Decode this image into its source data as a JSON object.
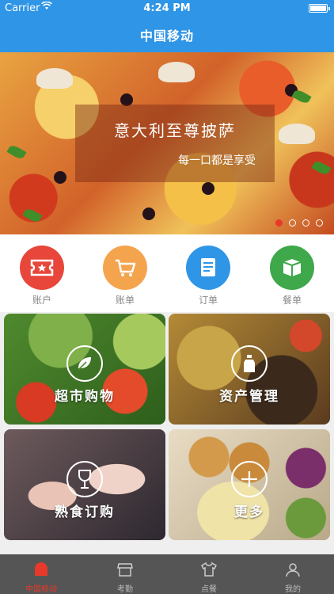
{
  "status_bar": {
    "carrier": "Carrier",
    "time": "4:24 PM"
  },
  "nav": {
    "title": "中国移动"
  },
  "banner": {
    "title": "意大利至尊披萨",
    "subtitle": "每一口都是享受",
    "page_count": 4,
    "active_page": 1
  },
  "quick_menu": [
    {
      "label": "账户",
      "icon": "ticket-icon",
      "color": "#e8463a"
    },
    {
      "label": "账单",
      "icon": "cart-icon",
      "color": "#f5a44e"
    },
    {
      "label": "订单",
      "icon": "document-icon",
      "color": "#2f95e6"
    },
    {
      "label": "餐单",
      "icon": "box-icon",
      "color": "#3ea84a"
    }
  ],
  "tiles": [
    {
      "label": "超市购物",
      "icon": "leaf-icon"
    },
    {
      "label": "资产管理",
      "icon": "bottle-icon"
    },
    {
      "label": "熟食订购",
      "icon": "wine-glass-icon"
    },
    {
      "label": "更多",
      "icon": "plus-icon"
    }
  ],
  "tab_bar": [
    {
      "label": "中国移动",
      "icon": "home-icon",
      "active": true
    },
    {
      "label": "考勤",
      "icon": "store-icon",
      "active": false
    },
    {
      "label": "点餐",
      "icon": "shirt-icon",
      "active": false
    },
    {
      "label": "我的",
      "icon": "person-icon",
      "active": false
    }
  ],
  "colors": {
    "header": "#2f95e6",
    "accent": "#e8392a",
    "tabbar": "#555555"
  }
}
